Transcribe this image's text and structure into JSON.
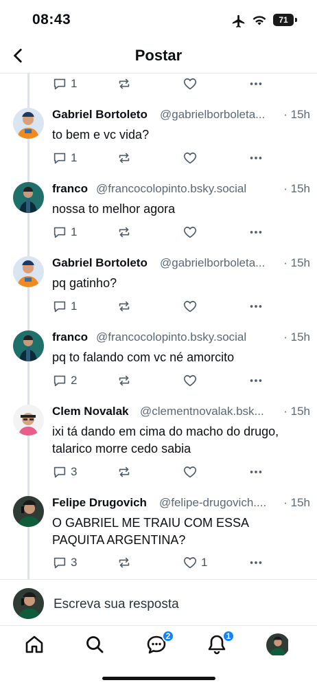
{
  "status": {
    "time": "08:43",
    "battery": "71"
  },
  "header": {
    "title": "Postar"
  },
  "top_actions": {
    "reply_count": "1"
  },
  "posts": [
    {
      "name": "Gabriel Bortoleto",
      "handle": "@gabrielborboleta...",
      "time": "· 15h",
      "text": "to bem e vc vida?",
      "replies": "1",
      "likes": ""
    },
    {
      "name": "franco",
      "handle": "@francocolopinto.bsky.social",
      "time": "· 15h",
      "text": "nossa to melhor agora",
      "replies": "1",
      "likes": ""
    },
    {
      "name": "Gabriel Bortoleto",
      "handle": "@gabrielborboleta...",
      "time": "· 15h",
      "text": "pq gatinho?",
      "replies": "1",
      "likes": ""
    },
    {
      "name": "franco",
      "handle": "@francocolopinto.bsky.social",
      "time": "· 15h",
      "text": "pq to falando com vc né amorcito",
      "replies": "2",
      "likes": ""
    },
    {
      "name": "Clem Novalak",
      "handle": "@clementnovalak.bsk...",
      "time": "· 15h",
      "text": "ixi tá dando em cima do macho do drugo, talarico morre cedo sabia",
      "replies": "3",
      "likes": ""
    },
    {
      "name": "Felipe Drugovich",
      "handle": "@felipe-drugovich....",
      "time": "· 15h",
      "text": "O GABRIEL ME TRAIU COM ESSA PAQUITA ARGENTINA?",
      "replies": "3",
      "likes": "1"
    }
  ],
  "reply_bar": {
    "placeholder": "Escreva sua resposta"
  },
  "tabbar": {
    "chat_badge": "2",
    "notifications_badge": "1"
  },
  "colors": {
    "accent": "#1083fe",
    "muted": "#5b6876",
    "divider": "#e6e9ec"
  },
  "icons": [
    "airplane-icon",
    "wifi-icon",
    "battery-icon",
    "back-arrow-icon",
    "reply-icon",
    "repost-icon",
    "heart-icon",
    "more-icon",
    "home-icon",
    "search-icon",
    "chat-icon",
    "bell-icon",
    "profile-avatar"
  ]
}
